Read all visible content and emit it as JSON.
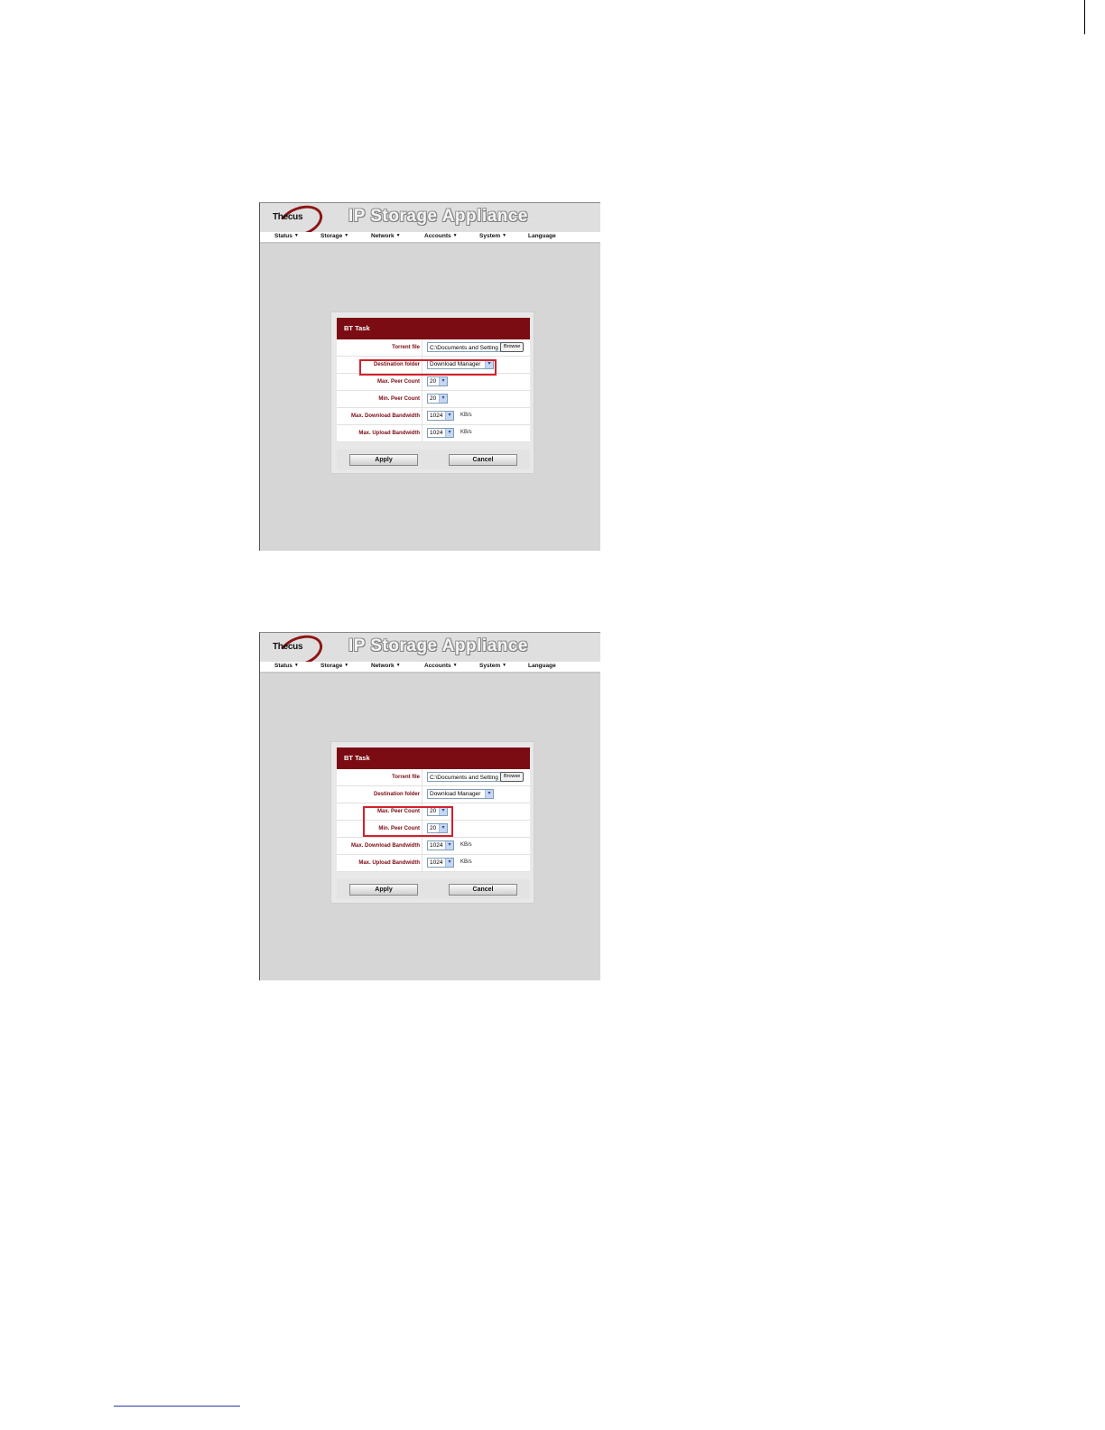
{
  "screenshots": [
    {
      "app": {
        "logo_text": "Thecus",
        "title": "IP Storage Appliance"
      },
      "menu": [
        {
          "label": "Status",
          "caret": "▼"
        },
        {
          "label": "Storage",
          "caret": "▼"
        },
        {
          "label": "Network",
          "caret": "▼"
        },
        {
          "label": "Accounts",
          "caret": "▼"
        },
        {
          "label": "System",
          "caret": "▼"
        },
        {
          "label": "Language",
          "caret": ""
        }
      ],
      "dialog": {
        "title": "BT Task",
        "torrent_file": {
          "label": "Torrent file",
          "value": "C:\\Documents and Setting",
          "browse": "Browse"
        },
        "destination_folder": {
          "label": "Destination folder",
          "value": "Download Manager"
        },
        "max_peer_count": {
          "label": "Max. Peer Count",
          "value": "20"
        },
        "min_peer_count": {
          "label": "Min. Peer Count",
          "value": "20"
        },
        "max_download_bandwidth": {
          "label": "Max. Download Bandwidth",
          "value": "1024",
          "unit": "KB/s"
        },
        "max_upload_bandwidth": {
          "label": "Max. Upload Bandwidth",
          "value": "1024",
          "unit": "KB/s"
        },
        "apply": "Apply",
        "cancel": "Cancel"
      },
      "highlighted_fields": [
        "Destination folder"
      ]
    },
    {
      "app": {
        "logo_text": "Thecus",
        "title": "IP Storage Appliance"
      },
      "menu": [
        {
          "label": "Status",
          "caret": "▼"
        },
        {
          "label": "Storage",
          "caret": "▼"
        },
        {
          "label": "Network",
          "caret": "▼"
        },
        {
          "label": "Accounts",
          "caret": "▼"
        },
        {
          "label": "System",
          "caret": "▼"
        },
        {
          "label": "Language",
          "caret": ""
        }
      ],
      "dialog": {
        "title": "BT Task",
        "torrent_file": {
          "label": "Torrent file",
          "value": "C:\\Documents and Setting",
          "browse": "Browse"
        },
        "destination_folder": {
          "label": "Destination folder",
          "value": "Download Manager"
        },
        "max_peer_count": {
          "label": "Max. Peer Count",
          "value": "20"
        },
        "min_peer_count": {
          "label": "Min. Peer Count",
          "value": "20"
        },
        "max_download_bandwidth": {
          "label": "Max. Download Bandwidth",
          "value": "1024",
          "unit": "KB/s"
        },
        "max_upload_bandwidth": {
          "label": "Max. Upload Bandwidth",
          "value": "1024",
          "unit": "KB/s"
        },
        "apply": "Apply",
        "cancel": "Cancel"
      },
      "highlighted_fields": [
        "Max. Peer Count",
        "Min. Peer Count"
      ]
    }
  ],
  "colors": {
    "accent": "#7b0c14",
    "highlight": "#d4202a",
    "page_background": "#d6d6d6"
  },
  "icons": [
    "thecus-logo",
    "chevron-down-icon"
  ]
}
